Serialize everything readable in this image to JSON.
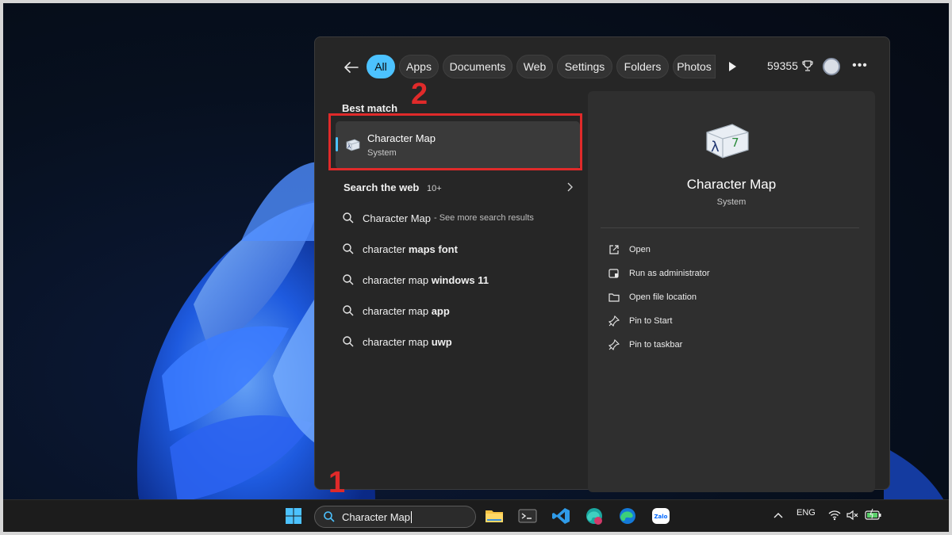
{
  "filters": {
    "chips": [
      "All",
      "Apps",
      "Documents",
      "Web",
      "Settings",
      "Folders",
      "Photos"
    ],
    "active": "All",
    "points": "59355"
  },
  "best_match": {
    "heading": "Best match",
    "app_name": "Character Map",
    "app_type": "System"
  },
  "search_web": {
    "heading": "Search the web",
    "count": "10+",
    "results": [
      {
        "bold": "Character Map",
        "light": "",
        "hint": "- See more search results"
      },
      {
        "bold": "",
        "light": "character ",
        "rest": "maps font"
      },
      {
        "bold": "",
        "light": "character map ",
        "rest": "windows 11"
      },
      {
        "bold": "",
        "light": "character map ",
        "rest": "app"
      },
      {
        "bold": "",
        "light": "character map ",
        "rest": "uwp"
      }
    ]
  },
  "details": {
    "title": "Character Map",
    "subtitle": "System",
    "actions": [
      "Open",
      "Run as administrator",
      "Open file location",
      "Pin to Start",
      "Pin to taskbar"
    ]
  },
  "annotations": {
    "step1": "1",
    "step2": "2",
    "color": "#e02a2a"
  },
  "taskbar": {
    "search_value": "Character Map",
    "language": "ENG",
    "icons": [
      "start-icon",
      "file-explorer-icon",
      "terminal-icon",
      "vscode-icon",
      "edge-dev-icon",
      "edge-icon",
      "zalo-icon"
    ],
    "zalo_label": "Zalo"
  },
  "colors": {
    "accent": "#4cc2ff",
    "panel": "#262626",
    "annotation": "#e02a2a"
  }
}
